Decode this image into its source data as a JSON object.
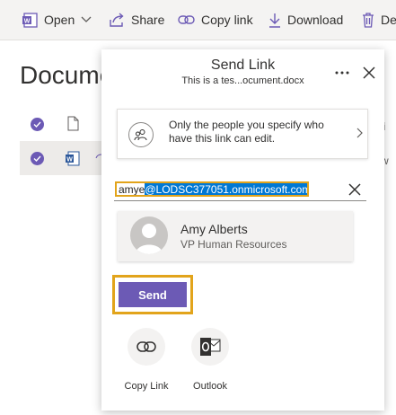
{
  "toolbar": {
    "open_label": "Open",
    "share_label": "Share",
    "copy_link_label": "Copy link",
    "download_label": "Download",
    "delete_label": "De"
  },
  "background": {
    "page_title": "Documents",
    "row1_right_text": "li",
    "row2_right_text": "w"
  },
  "panel": {
    "title": "Send Link",
    "subtitle": "This is a tes...ocument.docx",
    "permission_text": "Only the people you specify who have this link can edit.",
    "to_typed": "amye",
    "to_autocomplete": "@LODSC377051.onmicrosoft.com",
    "suggestion": {
      "name": "Amy Alberts",
      "role": "VP Human Resources"
    },
    "send_label": "Send",
    "share_options": [
      {
        "label": "Copy Link",
        "icon": "link-icon"
      },
      {
        "label": "Outlook",
        "icon": "outlook-icon"
      }
    ]
  },
  "colors": {
    "accent": "#6c5ab5",
    "highlight_outline": "#e2a41b",
    "selection": "#0078d4"
  }
}
